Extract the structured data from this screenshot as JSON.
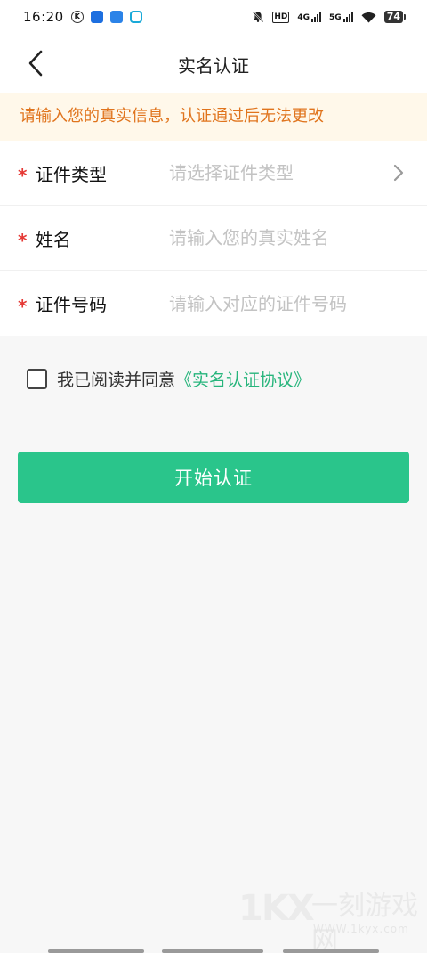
{
  "status_bar": {
    "time": "16:20",
    "network_4g": "4G",
    "network_5g": "5G",
    "battery": "74",
    "hd_label": "HD"
  },
  "nav": {
    "title": "实名认证"
  },
  "notice": {
    "text": "请输入您的真实信息，认证通过后无法更改"
  },
  "form": {
    "required_mark": "*",
    "fields": [
      {
        "label": "证件类型",
        "placeholder": "请选择证件类型"
      },
      {
        "label": "姓名",
        "placeholder": "请输入您的真实姓名"
      },
      {
        "label": "证件号码",
        "placeholder": "请输入对应的证件号码"
      }
    ]
  },
  "agreement": {
    "text": "我已阅读并同意",
    "link": "《实名认证协议》"
  },
  "submit": {
    "label": "开始认证"
  },
  "watermark": {
    "logo": "1KX",
    "brand": "一刻游戏网",
    "url": "WWW.1kyx.com"
  }
}
